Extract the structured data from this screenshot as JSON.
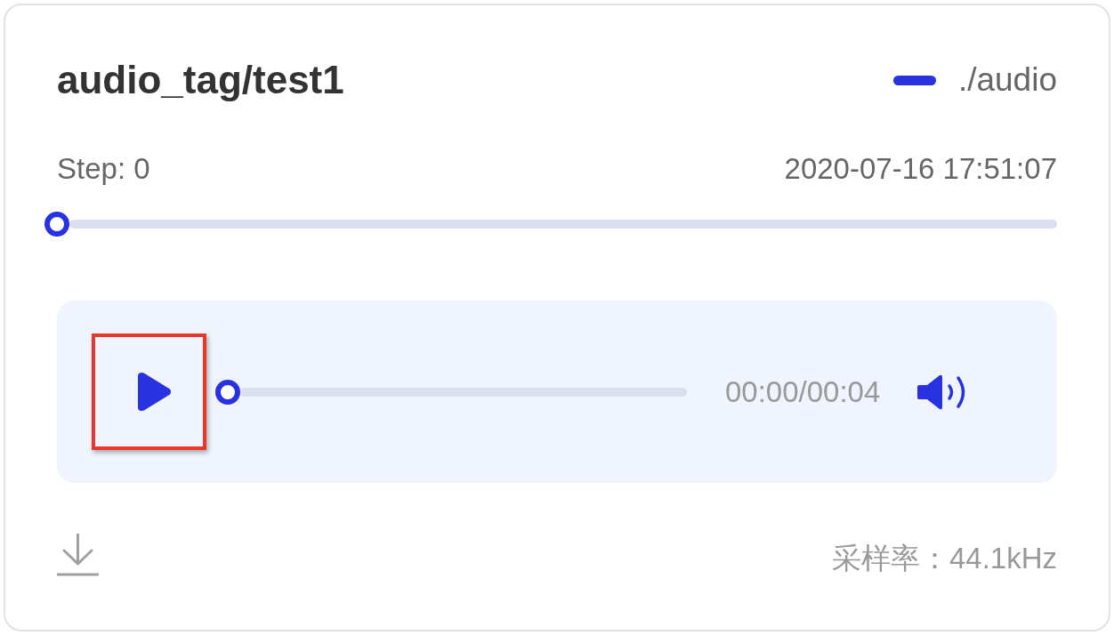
{
  "card": {
    "title": "audio_tag/test1",
    "legend": {
      "label": "./audio"
    },
    "step_label": "Step: 0",
    "timestamp": "2020-07-16 17:51:07",
    "step_slider": {
      "level": 0
    },
    "player": {
      "playing": false,
      "highlighted": true,
      "progress": {
        "level": 0
      },
      "time": "00:00/00:04",
      "muted": false
    },
    "sample_rate": "采样率：44.1kHz"
  }
}
